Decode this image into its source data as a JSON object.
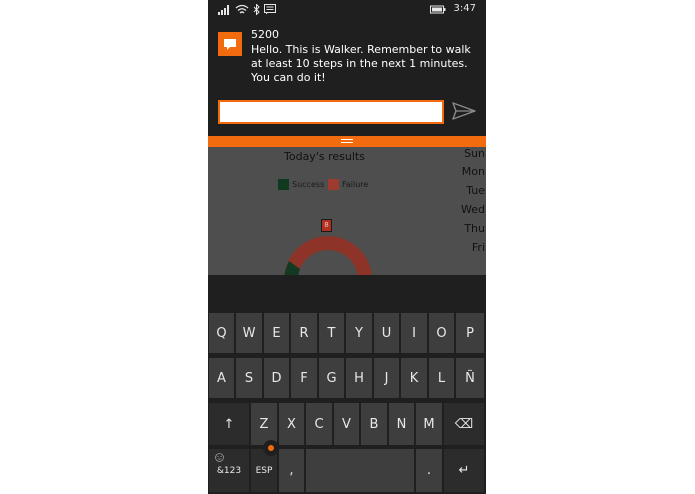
{
  "status_bar": {
    "time": "3:47",
    "icons": [
      "signal-icon",
      "wifi-icon",
      "bluetooth-icon",
      "message-icon",
      "battery-icon"
    ]
  },
  "notification": {
    "title": "5200",
    "body": "Hello. This is Walker. Remember to walk at least 10 steps in the next 1 minutes. You can do it!",
    "reply_placeholder": "",
    "accent_color": "#f26b0f"
  },
  "app": {
    "chart_title": "Today's results",
    "legend": [
      {
        "label": "Success",
        "color": "#0f3a1f"
      },
      {
        "label": "Failure",
        "color": "#9c3b2e"
      }
    ],
    "failure_count": "8",
    "days": [
      "Sun",
      "Mon",
      "Tue",
      "Wed",
      "Thu",
      "Fri"
    ]
  },
  "keyboard": {
    "row1": [
      "Q",
      "W",
      "E",
      "R",
      "T",
      "Y",
      "U",
      "I",
      "O",
      "P"
    ],
    "row2": [
      "A",
      "S",
      "D",
      "F",
      "G",
      "H",
      "J",
      "K",
      "L",
      "Ñ"
    ],
    "row3_letters": [
      "Z",
      "X",
      "C",
      "V",
      "B",
      "N",
      "M"
    ],
    "shift_label": "↑",
    "backspace_label": "⌫",
    "symbols_label": "&123",
    "lang_label": "ESP",
    "comma_label": ",",
    "period_label": ".",
    "enter_label": "↵",
    "space_label": ""
  }
}
